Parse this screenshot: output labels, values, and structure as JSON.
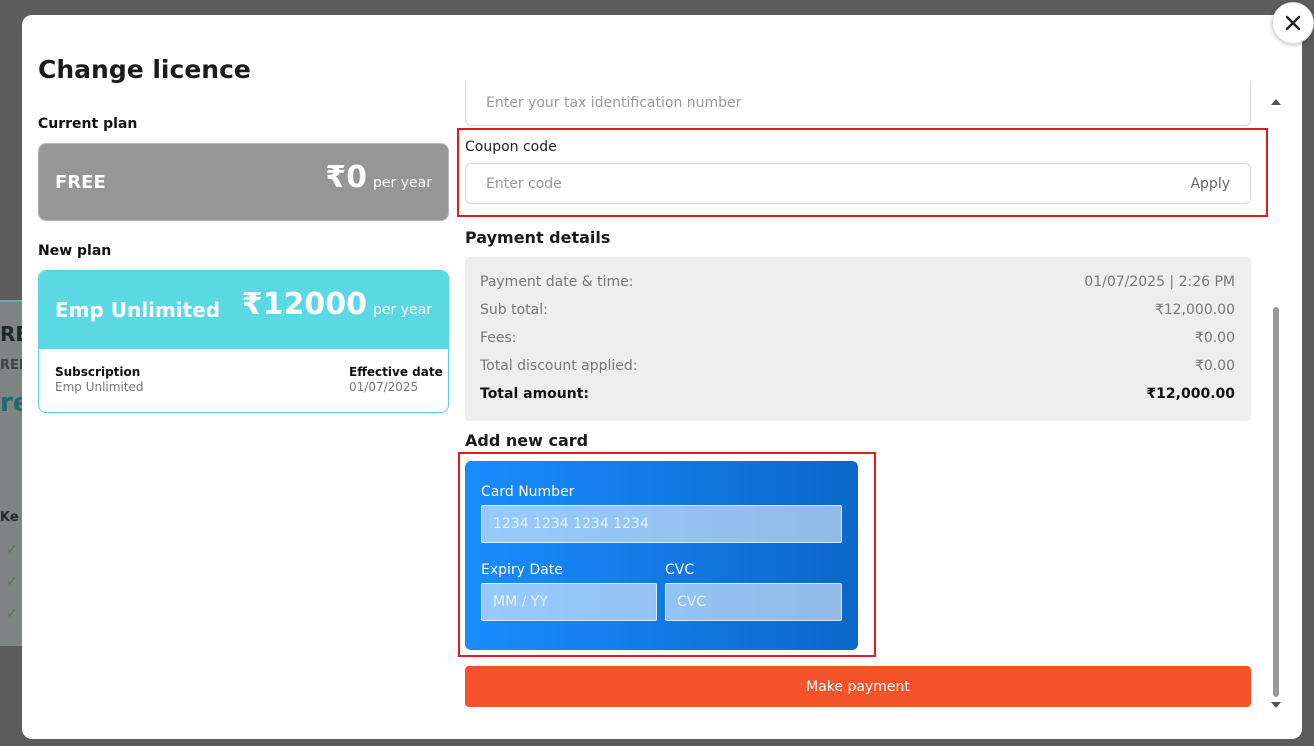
{
  "modal": {
    "title": "Change licence",
    "close_label": "×"
  },
  "current_plan": {
    "section_label": "Current plan",
    "name": "FREE",
    "price": "₹0",
    "period": "per year"
  },
  "new_plan": {
    "section_label": "New plan",
    "name": "Emp Unlimited",
    "price": "₹12000",
    "period": "per year",
    "subscription_label": "Subscription",
    "subscription_value": "Emp Unlimited",
    "effective_label": "Effective date",
    "effective_value": "01/07/2025"
  },
  "tax": {
    "placeholder": "Enter your tax identification number"
  },
  "coupon": {
    "label": "Coupon code",
    "placeholder": "Enter code",
    "apply_label": "Apply"
  },
  "payment": {
    "title": "Payment details",
    "rows": [
      {
        "label": "Payment date & time:",
        "value": "01/07/2025 | 2:26 PM"
      },
      {
        "label": "Sub total:",
        "value": "₹12,000.00"
      },
      {
        "label": "Fees:",
        "value": "₹0.00"
      },
      {
        "label": "Total discount applied:",
        "value": "₹0.00"
      },
      {
        "label": "Total amount:",
        "value": "₹12,000.00"
      }
    ]
  },
  "card": {
    "title": "Add new card",
    "number_label": "Card Number",
    "number_placeholder": "1234 1234 1234 1234",
    "expiry_label": "Expiry Date",
    "expiry_placeholder": "MM / YY",
    "cvc_label": "CVC",
    "cvc_placeholder": "CVC"
  },
  "actions": {
    "pay_label": "Make payment"
  },
  "background": {
    "fragments": [
      "RE",
      "REE",
      "re",
      "Ke"
    ]
  },
  "colors": {
    "accent_cyan": "#5ad8e4",
    "pay_orange": "#f4532a",
    "card_blue": "#1a8cff",
    "highlight_red": "#e01b24"
  }
}
